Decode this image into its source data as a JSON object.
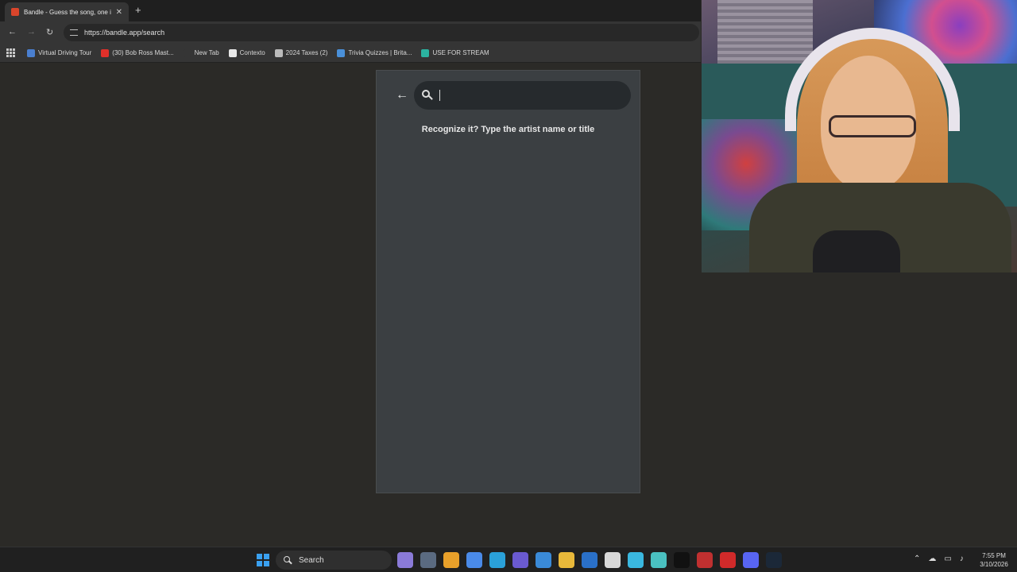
{
  "browser": {
    "tab_title": "Bandle - Guess the song, one in",
    "url": "https://bandle.app/search"
  },
  "bookmarks": [
    {
      "label": "Virtual Driving Tour",
      "icon": "globe-icon",
      "color": "#4a7fd0"
    },
    {
      "label": "(30) Bob Ross Mast...",
      "icon": "youtube-icon",
      "color": "#e0302a"
    },
    {
      "label": "New Tab",
      "icon": "blank-icon",
      "color": "#353535"
    },
    {
      "label": "Contexto",
      "icon": "contexto-icon",
      "color": "#e8e8e8"
    },
    {
      "label": "2024 Taxes (2)",
      "icon": "folder-icon",
      "color": "#bbbbbb"
    },
    {
      "label": "Trivia Quizzes | Brita...",
      "icon": "britannica-icon",
      "color": "#4a90d9"
    },
    {
      "label": "USE FOR STREAM",
      "icon": "p-icon",
      "color": "#2bb3a0"
    }
  ],
  "app": {
    "search_placeholder": "",
    "search_value": "",
    "hint": "Recognize it? Type the artist name or title"
  },
  "taskbar": {
    "search_label": "Search",
    "apps": [
      {
        "name": "copilot-icon",
        "color": "#8a7ad8"
      },
      {
        "name": "file-explorer-window-icon",
        "color": "#5a6a80"
      },
      {
        "name": "chrome-icon",
        "color": "#e8a02a"
      },
      {
        "name": "copilot-app-icon",
        "color": "#4a8ae8"
      },
      {
        "name": "edge-icon",
        "color": "#2aa0d8"
      },
      {
        "name": "teams-icon",
        "color": "#6a5ad0"
      },
      {
        "name": "photos-icon",
        "color": "#3a8ad8"
      },
      {
        "name": "folder-icon",
        "color": "#e8b83a"
      },
      {
        "name": "outlook-icon",
        "color": "#2a70c8"
      },
      {
        "name": "store-icon",
        "color": "#d8d8d8"
      },
      {
        "name": "todo-icon",
        "color": "#3ab8e0"
      },
      {
        "name": "remote-desktop-icon",
        "color": "#4ac0c0"
      },
      {
        "name": "capcut-icon",
        "color": "#111111"
      },
      {
        "name": "app-red-icon",
        "color": "#c03030"
      },
      {
        "name": "app-red2-icon",
        "color": "#d02a2a"
      },
      {
        "name": "discord-icon",
        "color": "#5865f2"
      },
      {
        "name": "steam-icon",
        "color": "#1b2838"
      }
    ],
    "time": "7:55 PM",
    "date": "3/10/2026"
  }
}
